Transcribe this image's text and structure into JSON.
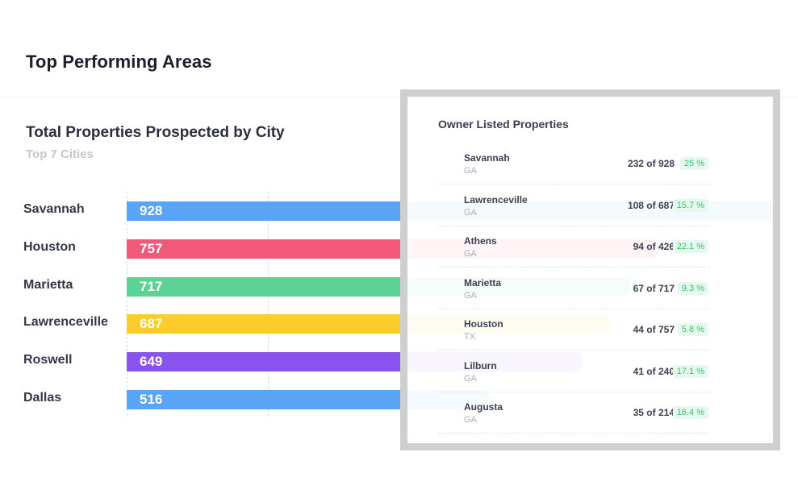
{
  "header": {
    "title": "Top Performing Areas"
  },
  "chart": {
    "title": "Total Properties Prospected by City",
    "subtitle": "Top 7 Cities"
  },
  "chart_data": {
    "type": "bar",
    "orientation": "horizontal",
    "title": "Total Properties Prospected by City",
    "subtitle": "Top 7 Cities",
    "categories": [
      "Savannah",
      "Houston",
      "Marietta",
      "Lawrenceville",
      "Roswell",
      "Dallas"
    ],
    "values": [
      928,
      757,
      717,
      687,
      649,
      516
    ],
    "labels": [
      "928",
      "757",
      "717",
      "687",
      "649",
      "516"
    ],
    "colors": [
      "#5aa4f7",
      "#f2587a",
      "#5cd394",
      "#fccd2a",
      "#8a53ee",
      "#5aa4f7"
    ],
    "xlim": [
      0,
      928
    ],
    "grid": true
  },
  "owner_listed": {
    "title": "Owner Listed Properties",
    "rows": [
      {
        "city": "Savannah",
        "state": "GA",
        "count": "232 of 928",
        "pct": "25 %"
      },
      {
        "city": "Lawrenceville",
        "state": "GA",
        "count": "108 of 687",
        "pct": "15.7 %"
      },
      {
        "city": "Athens",
        "state": "GA",
        "count": "94 of 426",
        "pct": "22.1 %"
      },
      {
        "city": "Marietta",
        "state": "GA",
        "count": "67 of 717",
        "pct": "9.3 %"
      },
      {
        "city": "Houston",
        "state": "TX",
        "count": "44 of 757",
        "pct": "5.8 %"
      },
      {
        "city": "Lilburn",
        "state": "GA",
        "count": "41 of 240",
        "pct": "17.1 %"
      },
      {
        "city": "Augusta",
        "state": "GA",
        "count": "35 of 214",
        "pct": "16.4 %"
      }
    ]
  }
}
